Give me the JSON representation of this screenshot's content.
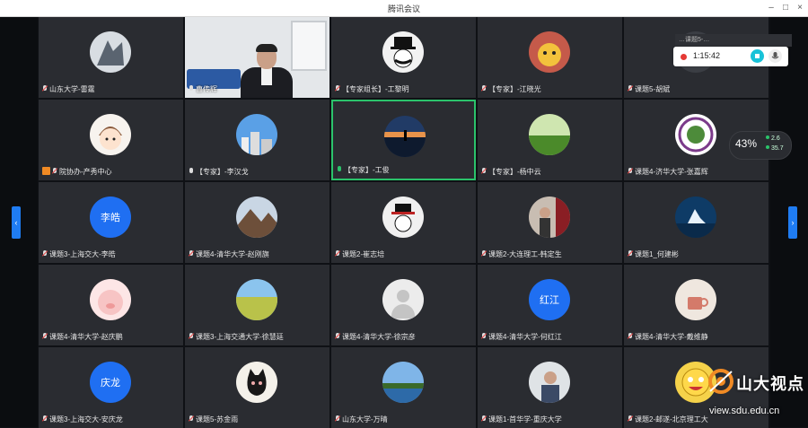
{
  "window": {
    "title": "腾讯会议"
  },
  "recording": {
    "time": "1:15:42"
  },
  "popup_text": "…课题5-…",
  "network": {
    "percent": "43%",
    "up": "2.6",
    "down": "35.7"
  },
  "watermark": {
    "name": "山大视点",
    "url": "view.sdu.edu.cn"
  },
  "participants": [
    {
      "label": "山东大学-雷霆",
      "mic": "muted",
      "avatar": "photo-art"
    },
    {
      "label": "曹传辉",
      "mic": "on",
      "avatar": "video"
    },
    {
      "label": "【专家组长】-工黎明",
      "mic": "muted",
      "avatar": "photo-cartoon"
    },
    {
      "label": "【专家】-江晓光",
      "mic": "muted",
      "avatar": "photo-animal"
    },
    {
      "label": "课题5-胡斌",
      "mic": "muted",
      "avatar": "photo-dark"
    },
    {
      "label": "院协办-产秀中心",
      "mic": "muted",
      "host": true,
      "avatar": "photo-boy"
    },
    {
      "label": "【专家】-李汉戈",
      "mic": "on",
      "avatar": "photo-city"
    },
    {
      "label": "【专家】-工俊",
      "mic": "speaking",
      "avatar": "photo-sunset"
    },
    {
      "label": "【专家】-杨中云",
      "mic": "muted",
      "avatar": "photo-grass"
    },
    {
      "label": "课题4-济华大学-张嘉辉",
      "mic": "muted",
      "avatar": "photo-flower"
    },
    {
      "label": "课题3-上海交大-李皓",
      "mic": "muted",
      "avatar": "text",
      "avatar_text": "李皓"
    },
    {
      "label": "课题4-清华大学-赵刚旗",
      "mic": "muted",
      "avatar": "photo-mountain"
    },
    {
      "label": "课题2-崔志培",
      "mic": "muted",
      "avatar": "photo-hat"
    },
    {
      "label": "课题2-大连理工-韩定生",
      "mic": "muted",
      "avatar": "photo-man"
    },
    {
      "label": "课题1_何建彬",
      "mic": "muted",
      "avatar": "photo-iceberg"
    },
    {
      "label": "课题4-清华大学-赵庆鹏",
      "mic": "muted",
      "avatar": "photo-pig"
    },
    {
      "label": "课题3-上海交通大学-徐慧廷",
      "mic": "muted",
      "avatar": "photo-field"
    },
    {
      "label": "课题4-清华大学-徐宗彦",
      "mic": "muted",
      "avatar": "default"
    },
    {
      "label": "课题4-清华大学-何红江",
      "mic": "muted",
      "avatar": "text",
      "avatar_text": "红江"
    },
    {
      "label": "课题4-清华大学-戴维静",
      "mic": "muted",
      "avatar": "photo-coffee"
    },
    {
      "label": "课题3-上海交大-安庆龙",
      "mic": "muted",
      "avatar": "text",
      "avatar_text": "庆龙"
    },
    {
      "label": "课题5-苏金雨",
      "mic": "muted",
      "avatar": "photo-cat"
    },
    {
      "label": "山东大学-万晴",
      "mic": "muted",
      "avatar": "photo-lake"
    },
    {
      "label": "课题1-首华学-重庆大学",
      "mic": "muted",
      "avatar": "photo-office"
    },
    {
      "label": "课题2-邮遂-北京理工大",
      "mic": "muted",
      "avatar": "photo-emoji"
    }
  ]
}
